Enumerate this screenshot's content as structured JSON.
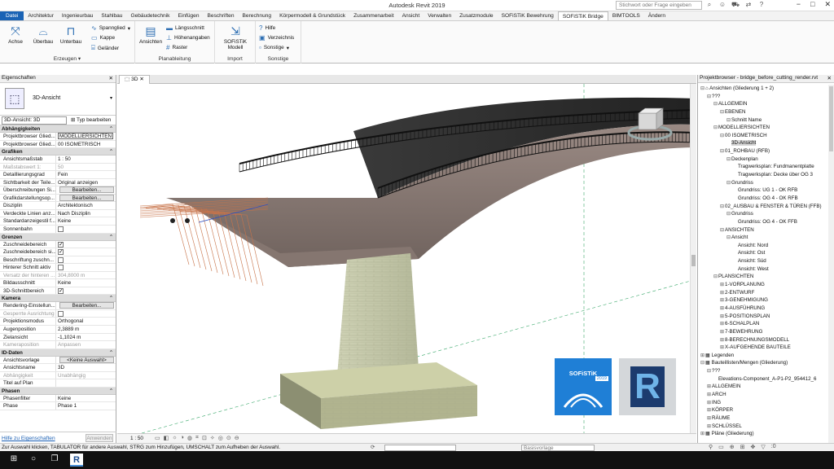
{
  "titlebar": {
    "title": "Autodesk Revit 2019",
    "search_placeholder": "Stichwort oder Frage eingeben",
    "icons": [
      "binoculars-icon",
      "user-icon",
      "cart-icon",
      "exchange-icon",
      "help-icon"
    ],
    "window_controls": [
      "−",
      "□",
      "✕"
    ]
  },
  "menu": {
    "file": "Datei",
    "tabs": [
      "Architektur",
      "Ingenieurbau",
      "Stahlbau",
      "Gebäudetechnik",
      "Einfügen",
      "Beschriften",
      "Berechnung",
      "Körpermodell & Grundstück",
      "Zusammenarbeit",
      "Ansicht",
      "Verwalten",
      "Zusatzmodule",
      "SOFiSTiK Bewehrung",
      "SOFiSTiK Bridge",
      "BIMTOOLS",
      "Ändern"
    ],
    "active": "SOFiSTiK Bridge"
  },
  "ribbon": {
    "erzeugen": {
      "title": "Erzeugen",
      "achse": "Achse",
      "ueberbau": "Überbau",
      "unterbau": "Unterbau",
      "spannglied": "Spannglied",
      "kappe": "Kappe",
      "gelaender": "Geländer"
    },
    "planableitung": {
      "title": "Planableitung",
      "ansichten": "Ansichten",
      "laengsschnitt": "Längsschnitt",
      "hoehenangaben": "Höhenangaben",
      "raster": "Raster"
    },
    "import": {
      "title": "Import",
      "sofistik_modell": "SOFiSTiK Modell"
    },
    "sonstige": {
      "title": "Sonstige",
      "hilfe": "Hilfe",
      "verzeichnis": "Verzeichnis",
      "sonstige": "Sonstige"
    }
  },
  "properties": {
    "title": "Eigenschaften",
    "type_name": "3D-Ansicht",
    "selector": "3D-Ansicht: 3D",
    "edit_type": "Typ bearbeiten",
    "groups": [
      {
        "name": "Abhängigkeiten",
        "rows": [
          {
            "k": "Projektbrowser Glied...",
            "v": "MODELLIERSICHTEN",
            "kind": "input"
          },
          {
            "k": "Projektbrowser Glied...",
            "v": "00 ISOMETRISCH"
          }
        ]
      },
      {
        "name": "Grafiken",
        "rows": [
          {
            "k": "Ansichtsmaßstab",
            "v": "1 : 50"
          },
          {
            "k": "Maßstabswert 1:",
            "v": "50",
            "gray": true
          },
          {
            "k": "Detaillierungsgrad",
            "v": "Fein"
          },
          {
            "k": "Sichtbarkeit der Teile...",
            "v": "Original anzeigen"
          },
          {
            "k": "Überschreibungen Si...",
            "v": "Bearbeiten...",
            "kind": "button"
          },
          {
            "k": "Grafikdarstellungsop...",
            "v": "Bearbeiten...",
            "kind": "button"
          },
          {
            "k": "Disziplin",
            "v": "Architektonisch"
          },
          {
            "k": "Verdeckte Linien anz...",
            "v": "Nach Disziplin"
          },
          {
            "k": "Standardanzeigestil f...",
            "v": "Keine"
          },
          {
            "k": "Sonnenbahn",
            "v": "",
            "kind": "check",
            "checked": false
          }
        ]
      },
      {
        "name": "Grenzen",
        "rows": [
          {
            "k": "Zuschneidebereich",
            "v": "",
            "kind": "check",
            "checked": true
          },
          {
            "k": "Zuschneidebereich si...",
            "v": "",
            "kind": "check",
            "checked": true
          },
          {
            "k": "Beschriftung zuschn...",
            "v": "",
            "kind": "check",
            "checked": false
          },
          {
            "k": "Hinterer Schnitt aktiv",
            "v": "",
            "kind": "check",
            "checked": false
          },
          {
            "k": "Versatz der hinteren ...",
            "v": "304,8000 m",
            "gray": true
          },
          {
            "k": "Bildausschnitt",
            "v": "Keine"
          },
          {
            "k": "3D-Schnittbereich",
            "v": "",
            "kind": "check",
            "checked": true
          }
        ]
      },
      {
        "name": "Kamera",
        "rows": [
          {
            "k": "Rendering-Einstellun...",
            "v": "Bearbeiten...",
            "kind": "button"
          },
          {
            "k": "Gesperrte Ausrichtung",
            "v": "",
            "kind": "check",
            "checked": false,
            "gray": true
          },
          {
            "k": "Projektionsmodus",
            "v": "Orthogonal"
          },
          {
            "k": "Augenposition",
            "v": "2,3889 m"
          },
          {
            "k": "Zielansicht",
            "v": "-1,1024 m"
          },
          {
            "k": "Kameraposition",
            "v": "Anpassen",
            "gray": true
          }
        ]
      },
      {
        "name": "ID-Daten",
        "rows": [
          {
            "k": "Ansichtsvorlage",
            "v": "<Keine Auswahl>",
            "kind": "button"
          },
          {
            "k": "Ansichtsname",
            "v": "3D"
          },
          {
            "k": "Abhängigkeit",
            "v": "Unabhängig",
            "gray": true
          },
          {
            "k": "Titel auf Plan",
            "v": ""
          }
        ]
      },
      {
        "name": "Phasen",
        "rows": [
          {
            "k": "Phasenfilter",
            "v": "Keine"
          },
          {
            "k": "Phase",
            "v": "Phase 1"
          }
        ]
      }
    ],
    "help_link": "Hilfe zu Eigenschaften",
    "apply": "Anwenden"
  },
  "view": {
    "tab": "3D",
    "scale": "1 : 50",
    "logos": {
      "sofistik": "SOFiSTiK",
      "sofistik_year": "2019",
      "revit": "R"
    }
  },
  "browser": {
    "title": "Projektbrowser - bridge_before_cutting_render.rvt",
    "nodes": [
      {
        "d": 0,
        "t": "−",
        "label": "Ansichten (Gliederung 1 + 2)",
        "icon": "⌂"
      },
      {
        "d": 1,
        "t": "−",
        "label": "???"
      },
      {
        "d": 2,
        "t": "−",
        "label": "ALLGEMEIN"
      },
      {
        "d": 3,
        "t": "−",
        "label": "EBENEN"
      },
      {
        "d": 4,
        "t": "−",
        "label": "Schnitt Name"
      },
      {
        "d": 2,
        "t": "−",
        "label": "MODELLIERSICHTEN"
      },
      {
        "d": 3,
        "t": "−",
        "label": "00 ISOMETRISCH"
      },
      {
        "d": 4,
        "t": "",
        "label": "3D-Ansicht",
        "sel": true
      },
      {
        "d": 3,
        "t": "−",
        "label": "01_ROHBAU (RFB)"
      },
      {
        "d": 4,
        "t": "−",
        "label": "Deckenplan"
      },
      {
        "d": 5,
        "t": "",
        "label": "Tragwerksplan: Fundmanentplatte"
      },
      {
        "d": 5,
        "t": "",
        "label": "Tragwerksplan: Decke über OG 3"
      },
      {
        "d": 4,
        "t": "−",
        "label": "Grundriss"
      },
      {
        "d": 5,
        "t": "",
        "label": "Grundriss: UG 1 - OK RFB"
      },
      {
        "d": 5,
        "t": "",
        "label": "Grundriss: OG 4 - OK RFB"
      },
      {
        "d": 3,
        "t": "−",
        "label": "02_AUSBAU & FENSTER & TÜREN (FFB)"
      },
      {
        "d": 4,
        "t": "−",
        "label": "Grundriss"
      },
      {
        "d": 5,
        "t": "",
        "label": "Grundriss: OG 4 - OK FFB"
      },
      {
        "d": 3,
        "t": "−",
        "label": "ANSICHTEN"
      },
      {
        "d": 4,
        "t": "−",
        "label": "Ansicht"
      },
      {
        "d": 5,
        "t": "",
        "label": "Ansicht: Nord"
      },
      {
        "d": 5,
        "t": "",
        "label": "Ansicht: Ost"
      },
      {
        "d": 5,
        "t": "",
        "label": "Ansicht: Süd"
      },
      {
        "d": 5,
        "t": "",
        "label": "Ansicht: West"
      },
      {
        "d": 2,
        "t": "−",
        "label": "PLANSICHTEN"
      },
      {
        "d": 3,
        "t": "+",
        "label": "1-VORPLANUNG"
      },
      {
        "d": 3,
        "t": "+",
        "label": "2-ENTWURF"
      },
      {
        "d": 3,
        "t": "+",
        "label": "3-GENEHMIGUNG"
      },
      {
        "d": 3,
        "t": "+",
        "label": "4-AUSFÜHRUNG"
      },
      {
        "d": 3,
        "t": "+",
        "label": "5-POSITIONSPLAN"
      },
      {
        "d": 3,
        "t": "+",
        "label": "6-SCHALPLAN"
      },
      {
        "d": 3,
        "t": "+",
        "label": "7-BEWEHRUNG"
      },
      {
        "d": 3,
        "t": "+",
        "label": "8-BERECHNUNGSMODELL"
      },
      {
        "d": 3,
        "t": "+",
        "label": "X-AUFGEHENDE BAUTEILE"
      },
      {
        "d": 0,
        "t": "+",
        "label": "Legenden",
        "icon": "▦"
      },
      {
        "d": 0,
        "t": "−",
        "label": "Bauteillisten/Mengen (Gliederung)",
        "icon": "▦"
      },
      {
        "d": 1,
        "t": "−",
        "label": "???"
      },
      {
        "d": 2,
        "t": "",
        "label": "Elevations-Component_A-P1-P2_954412_6"
      },
      {
        "d": 1,
        "t": "+",
        "label": "ALLGEMEIN"
      },
      {
        "d": 1,
        "t": "+",
        "label": "ARCH"
      },
      {
        "d": 1,
        "t": "+",
        "label": "ING"
      },
      {
        "d": 1,
        "t": "+",
        "label": "KÖRPER"
      },
      {
        "d": 1,
        "t": "+",
        "label": "RÄUME"
      },
      {
        "d": 1,
        "t": "+",
        "label": "SCHLÜSSEL"
      },
      {
        "d": 0,
        "t": "+",
        "label": "Pläne (Gliederung)",
        "icon": "▦"
      }
    ]
  },
  "status": {
    "message": "Zur Auswahl klicken, TABULATOR für andere Auswahl, STRG zum Hinzufügen, UMSCHALT zum Aufheben der Auswahl.",
    "model": "Basisvorlage",
    "filter_value": ":0"
  },
  "taskbar": {
    "revit_label": "R"
  }
}
